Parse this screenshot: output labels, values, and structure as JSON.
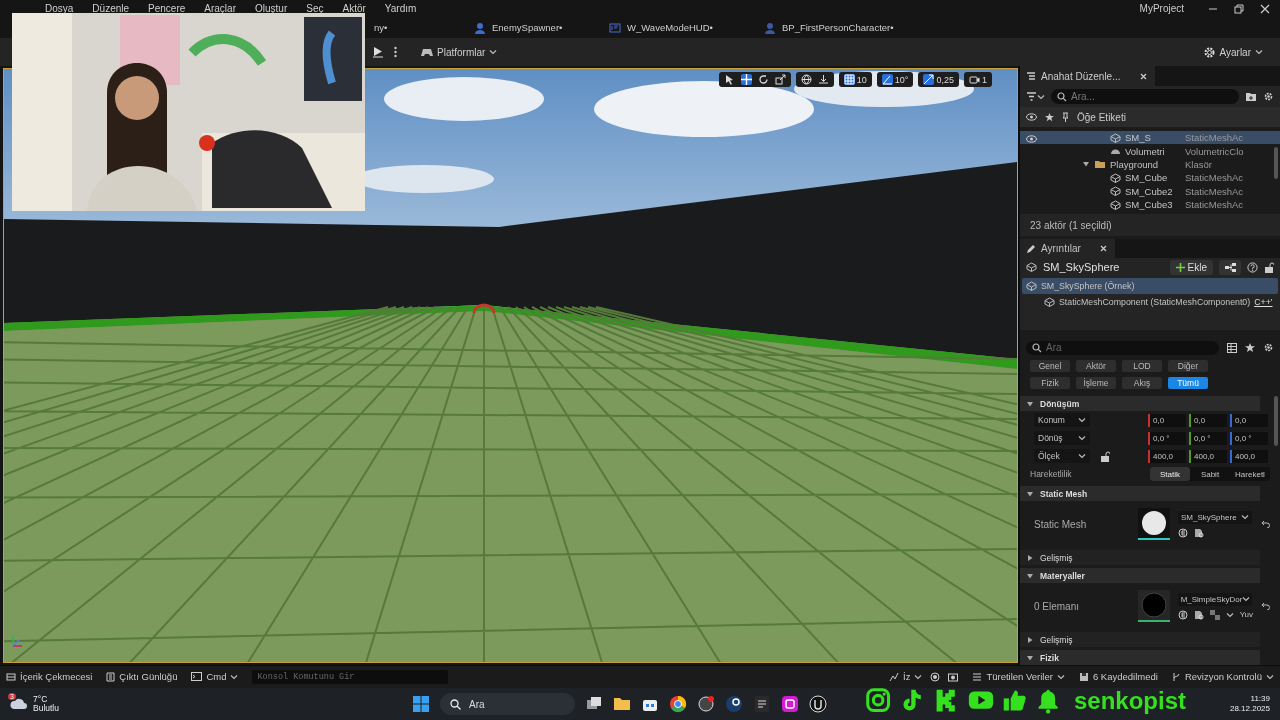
{
  "menu": [
    "Dosya",
    "Düzenle",
    "Pencere",
    "Araçlar",
    "Oluştur",
    "Seç",
    "Aktör",
    "Yardım"
  ],
  "window": {
    "title": "MyProject"
  },
  "document_tabs": [
    {
      "label": "ny•",
      "selected": false
    },
    {
      "label": "EnemySpawner•",
      "kind": "blueprint",
      "selected": false
    },
    {
      "label": "W_WaveModeHUD•",
      "kind": "widget",
      "selected": false
    },
    {
      "label": "BP_FirstPersonCharacter•",
      "kind": "character",
      "selected": false
    }
  ],
  "toolbar": {
    "platforms": "Platformlar",
    "settings": "Ayarlar"
  },
  "viewport": {
    "grid_snap": "10",
    "angle_snap": "10°",
    "scale_snap": "0,25",
    "camera_speed": "1",
    "grid_snap_on": true,
    "angle_snap_on": true,
    "scale_snap_on": true
  },
  "outliner": {
    "tab": "Anahat Düzenle...",
    "search_placeholder": "Ara...",
    "column_1": "Öğe Etiketi",
    "rows": [
      {
        "name": "SM_S",
        "type": "StaticMeshAc",
        "kind": "mesh",
        "selected": true
      },
      {
        "name": "Volumetri",
        "type": "VolumetricClo",
        "kind": "cloud",
        "selected": false
      },
      {
        "name": "Playground",
        "type": "Klasör",
        "kind": "folder",
        "selected": false,
        "expanded": true,
        "children": [
          {
            "name": "SM_Cube",
            "type": "StaticMeshAc",
            "kind": "mesh",
            "selected": false
          },
          {
            "name": "SM_Cube2",
            "type": "StaticMeshAc",
            "kind": "mesh",
            "selected": false
          },
          {
            "name": "SM_Cube3",
            "type": "StaticMeshAc",
            "kind": "mesh",
            "selected": false
          }
        ]
      }
    ],
    "status": "23 aktör (1 seçildi)"
  },
  "details": {
    "tab": "Ayrıntılar",
    "actor": "SM_SkySphere",
    "add_button": "Ekle",
    "components": [
      {
        "label": "SM_SkySphere (Örnek)",
        "selected": true,
        "children": [
          {
            "label": "StaticMeshComponent (StaticMeshComponent0)",
            "badge": "C++'",
            "selected": false
          }
        ]
      }
    ],
    "search_placeholder": "Ara",
    "filters": [
      {
        "label": "Genel",
        "selected": false
      },
      {
        "label": "Aktör",
        "selected": false
      },
      {
        "label": "LOD",
        "selected": false
      },
      {
        "label": "Diğer",
        "selected": false
      },
      {
        "label": "Fizik",
        "selected": false
      },
      {
        "label": "İşleme",
        "selected": false
      },
      {
        "label": "Akış",
        "selected": false
      },
      {
        "label": "Tümü",
        "selected": true
      }
    ],
    "sections": [
      {
        "kind": "transform",
        "title": "Dönüşüm",
        "expanded": true,
        "rows": [
          {
            "label": "Konum",
            "values": [
              "0,0",
              "0,0",
              "0,0"
            ]
          },
          {
            "label": "Dönüş",
            "values": [
              "0,0 °",
              "0,0 °",
              "0,0 °"
            ]
          },
          {
            "label": "Ölçek",
            "values": [
              "400,0",
              "400,0",
              "400,0"
            ],
            "locked": false
          }
        ],
        "mobility": {
          "label": "Hareketlilik",
          "options": [
            {
              "label": "Statik",
              "selected": true
            },
            {
              "label": "Sabit",
              "selected": false
            },
            {
              "label": "Hareketl",
              "selected": false
            }
          ]
        }
      },
      {
        "kind": "asset",
        "title": "Static Mesh",
        "expanded": true,
        "label": "Static Mesh",
        "asset": "SM_SkySphere",
        "thumbnail_dark": false
      },
      {
        "kind": "sub",
        "title": "Gelişmiş",
        "expanded": false
      },
      {
        "kind": "asset",
        "title": "Materyaller",
        "expanded": true,
        "label": "0 Elemanı",
        "asset": "M_SimpleSkyDor",
        "thumbnail_dark": true,
        "extra": "Yuv"
      },
      {
        "kind": "sub",
        "title": "Gelişmiş",
        "expanded": false
      },
      {
        "kind": "header",
        "title": "Fizik",
        "expanded": true
      }
    ]
  },
  "bottom_bar": {
    "content_drawer": "İçerik Çekmecesi",
    "output_log": "Çıktı Günlüğü",
    "cmd": "Cmd",
    "console_placeholder": "Konsol Komutunu Gir",
    "trace": "İz",
    "derived_data": "Türetilen Veriler",
    "unsaved": "6 Kaydedilmedi",
    "revision": "Revizyon Kontrolü"
  },
  "taskbar": {
    "weather_temp": "7°C",
    "weather_text": "Bulutlu",
    "notification_count": "3",
    "search_placeholder": "Ara",
    "time": "11:39",
    "date": "28.12.2025"
  },
  "overlay": {
    "handle": "senkopist"
  }
}
